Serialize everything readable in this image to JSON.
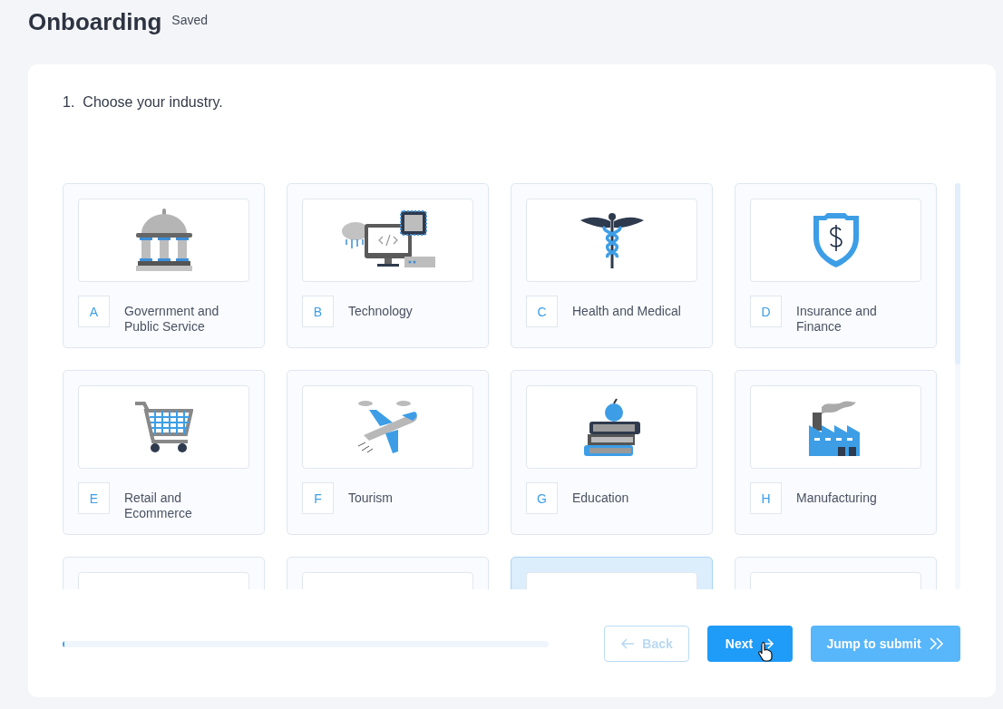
{
  "header": {
    "title": "Onboarding",
    "status": "Saved"
  },
  "question": {
    "number": "1.",
    "text": "Choose your industry."
  },
  "options": [
    {
      "letter": "A",
      "label": "Government and Public Service",
      "kind": "building",
      "selected": false
    },
    {
      "letter": "B",
      "label": "Technology",
      "kind": "computer",
      "selected": false
    },
    {
      "letter": "C",
      "label": "Health and Medical",
      "kind": "caduceus",
      "selected": false
    },
    {
      "letter": "D",
      "label": "Insurance and Finance",
      "kind": "shield",
      "selected": false
    },
    {
      "letter": "E",
      "label": "Retail and Ecommerce",
      "kind": "cart",
      "selected": false
    },
    {
      "letter": "F",
      "label": "Tourism",
      "kind": "plane",
      "selected": false
    },
    {
      "letter": "G",
      "label": "Education",
      "kind": "books",
      "selected": false
    },
    {
      "letter": "H",
      "label": "Manufacturing",
      "kind": "factory",
      "selected": false
    },
    {
      "kind": "partial",
      "selected": false
    },
    {
      "kind": "partial",
      "selected": false
    },
    {
      "kind": "partial",
      "selected": true
    },
    {
      "kind": "partial",
      "selected": false
    }
  ],
  "progress": {
    "level": 0.003
  },
  "buttons": {
    "back": {
      "label": "Back",
      "disabled": true
    },
    "next": {
      "label": "Next"
    },
    "jump": {
      "label": "Jump to submit"
    }
  }
}
